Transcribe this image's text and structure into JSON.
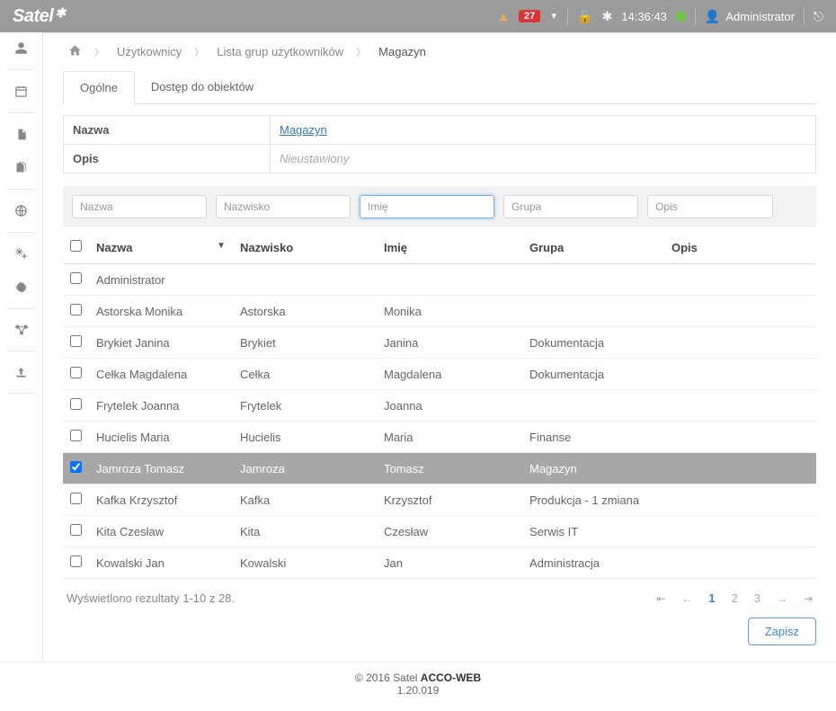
{
  "topbar": {
    "brand": "Satel",
    "warning_badge": "27",
    "time": "14:36:43",
    "user_label": "Administrator"
  },
  "breadcrumb": {
    "item1": "Użytkownicy",
    "item2": "Lista grup użytkowników",
    "item3": "Magazyn"
  },
  "tabs": {
    "general": "Ogólne",
    "access": "Dostęp do obiektów"
  },
  "info": {
    "name_label": "Nazwa",
    "name_value": "Magazyn",
    "desc_label": "Opis",
    "desc_placeholder": "Nieustawiony"
  },
  "filters": {
    "nazwa": "Nazwa",
    "nazwisko": "Nazwisko",
    "imie": "Imię",
    "grupa": "Grupa",
    "opis": "Opis"
  },
  "columns": {
    "nazwa": "Nazwa",
    "nazwisko": "Nazwisko",
    "imie": "Imię",
    "grupa": "Grupa",
    "opis": "Opis"
  },
  "rows": [
    {
      "checked": false,
      "nazwa": "Administrator",
      "nazwisko": "",
      "imie": "",
      "grupa": "",
      "opis": "",
      "selected": false
    },
    {
      "checked": false,
      "nazwa": "Astorska Monika",
      "nazwisko": "Astorska",
      "imie": "Monika",
      "grupa": "",
      "opis": "",
      "selected": false
    },
    {
      "checked": false,
      "nazwa": "Brykiet Janina",
      "nazwisko": "Brykiet",
      "imie": "Janina",
      "grupa": "Dokumentacja",
      "opis": "",
      "selected": false
    },
    {
      "checked": false,
      "nazwa": "Cełka Magdalena",
      "nazwisko": "Cełka",
      "imie": "Magdalena",
      "grupa": "Dokumentacja",
      "opis": "",
      "selected": false
    },
    {
      "checked": false,
      "nazwa": "Frytelek Joanna",
      "nazwisko": "Frytelek",
      "imie": "Joanna",
      "grupa": "",
      "opis": "",
      "selected": false
    },
    {
      "checked": false,
      "nazwa": "Hucielis Maria",
      "nazwisko": "Hucielis",
      "imie": "Maria",
      "grupa": "Finanse",
      "opis": "",
      "selected": false
    },
    {
      "checked": true,
      "nazwa": "Jamroza Tomasz",
      "nazwisko": "Jamroza",
      "imie": "Tomasz",
      "grupa": "Magazyn",
      "opis": "",
      "selected": true
    },
    {
      "checked": false,
      "nazwa": "Kafka Krzysztof",
      "nazwisko": "Kafka",
      "imie": "Krzysztof",
      "grupa": "Produkcja - 1 zmiana",
      "opis": "",
      "selected": false
    },
    {
      "checked": false,
      "nazwa": "Kita Czesław",
      "nazwisko": "Kita",
      "imie": "Czesław",
      "grupa": "Serwis IT",
      "opis": "",
      "selected": false
    },
    {
      "checked": false,
      "nazwa": "Kowalski Jan",
      "nazwisko": "Kowalski",
      "imie": "Jan",
      "grupa": "Administracja",
      "opis": "",
      "selected": false
    }
  ],
  "results_text": "Wyświetlono rezultaty 1-10 z 28.",
  "pagination": {
    "p1": "1",
    "p2": "2",
    "p3": "3"
  },
  "save_label": "Zapisz",
  "footer": {
    "line1_prefix": "© 2016 Satel ",
    "line1_bold": "ACCO-WEB",
    "line2": "1.20.019"
  }
}
